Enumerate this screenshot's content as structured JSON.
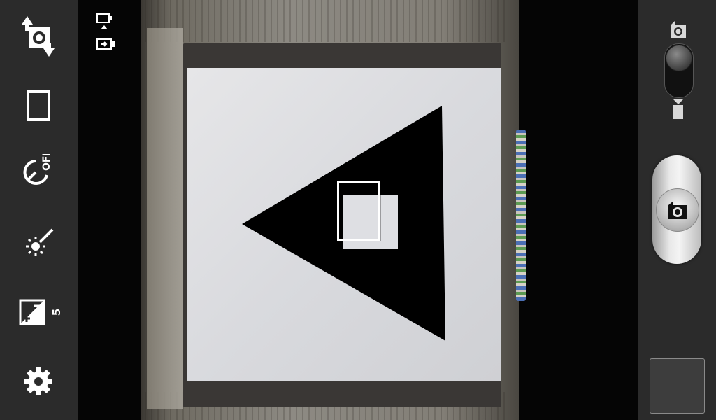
{
  "left_toolbar": {
    "items": [
      {
        "id": "switch-camera",
        "icon": "switch-camera-icon"
      },
      {
        "id": "shooting-mode",
        "icon": "shooting-mode-icon"
      },
      {
        "id": "timer",
        "icon": "timer-off-icon"
      },
      {
        "id": "flash",
        "icon": "flash-off-icon"
      },
      {
        "id": "exposure",
        "icon": "exposure-icon",
        "value": "5"
      },
      {
        "id": "settings",
        "icon": "gear-icon"
      }
    ]
  },
  "viewfinder": {
    "overlay_icons": [
      "aspect-ratio-icon",
      "storage-icon"
    ],
    "focus_indicator": "focus-box"
  },
  "right_panel": {
    "mode_switch": {
      "top_icon": "camera-mode-icon",
      "bottom_icon": "video-mode-icon",
      "selected": "camera"
    },
    "shutter": {
      "icon": "camera-shutter-icon"
    },
    "thumbnail": {
      "icon": "gallery-thumbnail"
    }
  },
  "colors": {
    "panel": "#2b2b2b",
    "icon": "#ffffff",
    "focus": "#ffffff"
  }
}
